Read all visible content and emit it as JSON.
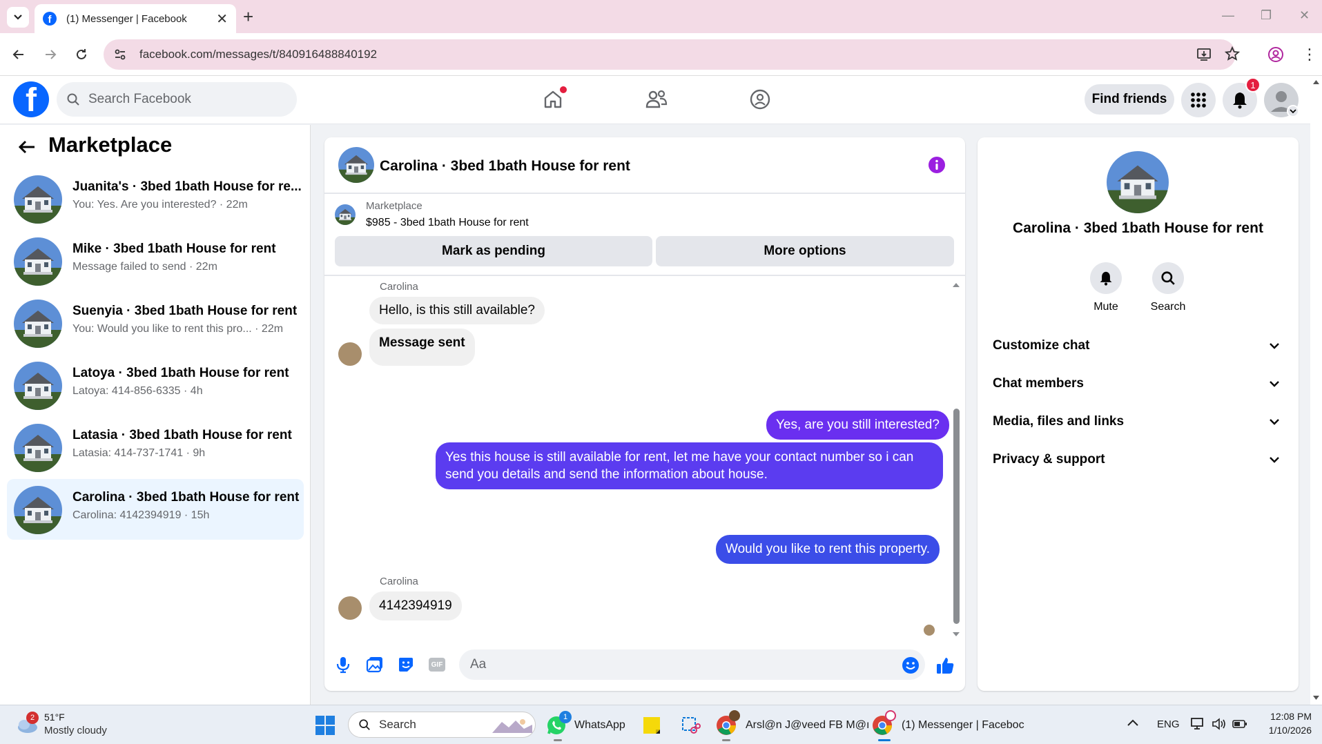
{
  "browser": {
    "tab_title": "(1) Messenger | Facebook",
    "url": "facebook.com/messages/t/840916488840192"
  },
  "header": {
    "search_placeholder": "Search Facebook",
    "find_friends_label": "Find friends",
    "notification_count": "1"
  },
  "sidebar": {
    "title": "Marketplace",
    "conversations": [
      {
        "name": "Juanita's · 3bed 1bath House for re...",
        "snippet": "You: Yes. Are you interested? · 22m"
      },
      {
        "name": "Mike · 3bed 1bath House for rent",
        "snippet": "Message failed to send · 22m"
      },
      {
        "name": "Suenyia · 3bed 1bath House for rent",
        "snippet": "You: Would you like to rent this pro... · 22m"
      },
      {
        "name": "Latoya · 3bed 1bath House for rent",
        "snippet": "Latoya: 414-856-6335 · 4h"
      },
      {
        "name": "Latasia · 3bed 1bath House for rent",
        "snippet": "Latasia: 414-737-1741 · 9h"
      },
      {
        "name": "Carolina · 3bed 1bath House for rent",
        "snippet": "Carolina: 4142394919 · 15h"
      }
    ]
  },
  "chat": {
    "title": "Carolina · 3bed 1bath House for rent",
    "marketplace_label": "Marketplace",
    "listing": "$985 - 3bed 1bath House for rent",
    "mark_pending_label": "Mark as pending",
    "more_options_label": "More options",
    "messages": [
      {
        "sender": "Carolina",
        "text": "Hello, is this still available?"
      },
      {
        "text": "Message sent"
      },
      {
        "text": "Yes, are you still interested?"
      },
      {
        "text": "Yes this house is still available for rent, let me have your contact number so i can send you details and send the information about house."
      },
      {
        "text": "Would you like to rent this property."
      },
      {
        "sender": "Carolina",
        "text": "4142394919"
      }
    ],
    "composer_placeholder": "Aa",
    "gif_label": "GIF",
    "outgoing_color": "#5b3cf0"
  },
  "info_panel": {
    "name": "Carolina · 3bed 1bath House for rent",
    "mute_label": "Mute",
    "search_label": "Search",
    "rows": [
      "Customize chat",
      "Chat members",
      "Media, files and links",
      "Privacy & support"
    ]
  },
  "taskbar": {
    "weather_temp": "51°F",
    "weather_desc": "Mostly cloudy",
    "weather_badge": "2",
    "search_label": "Search",
    "whatsapp_label": "WhatsApp",
    "whatsapp_badge": "1",
    "chrome_window1": "Arsl@n J@veed FB M@ı",
    "chrome_window2": "(1) Messenger | Faceboc",
    "lang": "ENG",
    "time": "12:08 PM",
    "date": "1/10/2026"
  }
}
